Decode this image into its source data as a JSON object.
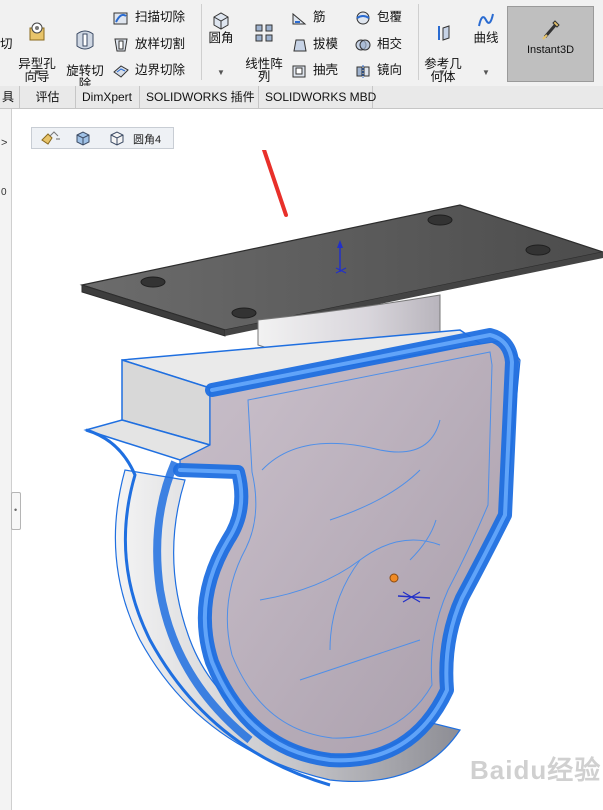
{
  "ribbon": {
    "cut_label": "切",
    "hole_wizard": "异型孔\n向导",
    "revolve_cut": "旋转切\n除",
    "sweep_cut": "扫描切除",
    "loft_cut": "放样切割",
    "boundary_cut": "边界切除",
    "fillet": "圆角",
    "linear_pattern": "线性阵\n列",
    "rib": "筋",
    "draft": "拔模",
    "shell": "抽壳",
    "wrap": "包覆",
    "intersect": "相交",
    "mirror": "镜向",
    "ref_geometry": "参考几\n何体",
    "curves": "曲线",
    "instant3d": "Instant3D"
  },
  "tabs": [
    "具",
    "评估",
    "DimXpert",
    "SOLIDWORKS 插件",
    "SOLIDWORKS MBD"
  ],
  "left_panel": {
    "arrow": ">",
    "digit": "0"
  },
  "breadcrumb": {
    "label": "圆角4"
  },
  "watermark": "Baidu经验",
  "colors": {
    "selection_blue": "#1f6fe0",
    "highlight_arrow": "#e8302a",
    "body_face": "#b8aeb8",
    "plate": "#5a5a5a"
  }
}
